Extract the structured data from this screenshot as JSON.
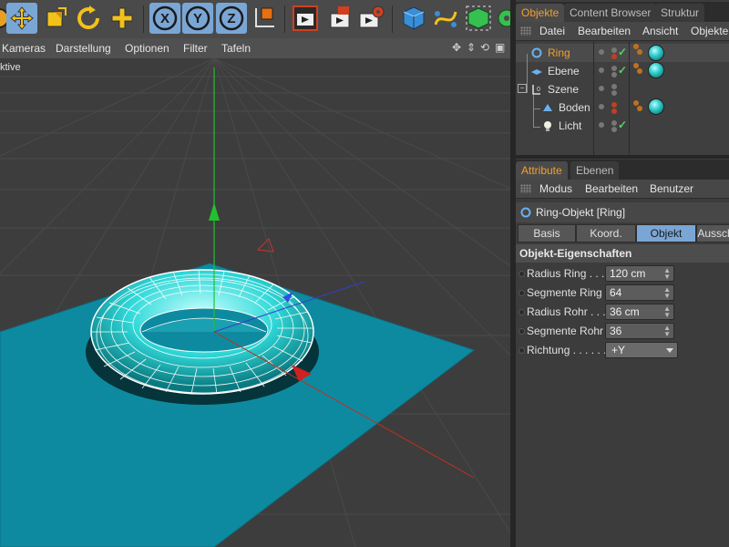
{
  "viewport_menu": {
    "items": [
      "Kameras",
      "Darstellung",
      "Optionen",
      "Filter",
      "Tafeln"
    ],
    "label": "ktive"
  },
  "objects_panel": {
    "tabs": [
      "Objekte",
      "Content Browser",
      "Struktur"
    ],
    "menu": [
      "Datei",
      "Bearbeiten",
      "Ansicht",
      "Objekte"
    ],
    "rows": [
      {
        "name": "Ring"
      },
      {
        "name": "Ebene"
      },
      {
        "name": "Szene"
      },
      {
        "name": "Boden"
      },
      {
        "name": "Licht"
      }
    ]
  },
  "attributes_panel": {
    "tabs": [
      "Attribute",
      "Ebenen"
    ],
    "menu": [
      "Modus",
      "Bearbeiten",
      "Benutzer"
    ],
    "object_title": "Ring-Objekt [Ring]",
    "subtabs": [
      "Basis",
      "Koord.",
      "Objekt",
      "Aussch"
    ],
    "section_title": "Objekt-Eigenschaften",
    "properties": [
      {
        "label": "Radius Ring . . .",
        "value": "120 cm"
      },
      {
        "label": "Segmente Ring",
        "value": "64"
      },
      {
        "label": "Radius Rohr . . .",
        "value": "36 cm"
      },
      {
        "label": "Segmente Rohr",
        "value": "36"
      },
      {
        "label": "Richtung . . . . . .",
        "value": "+Y"
      }
    ]
  },
  "colors": {
    "accent_orange": "#f0a030",
    "selection_blue": "#7aa6d6",
    "torus_cyan": "#30d8d8",
    "plane_teal": "#0e8aa0"
  }
}
